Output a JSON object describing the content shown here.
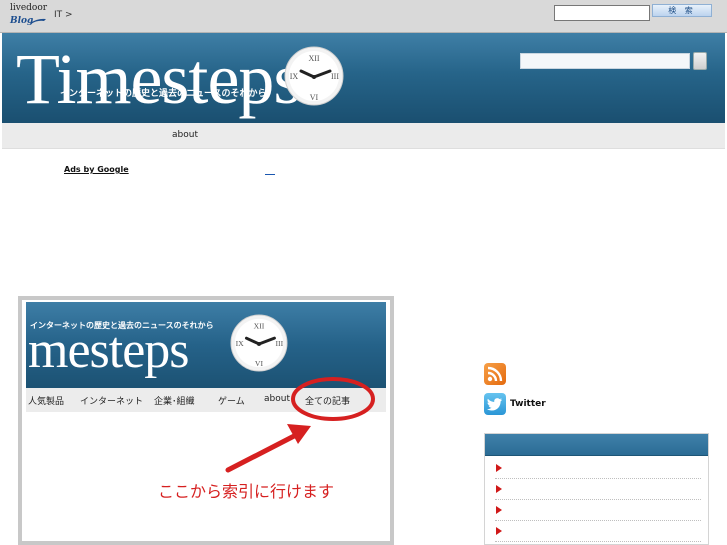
{
  "topbar": {
    "logo_text": "livedoor",
    "logo_blog": "Blog",
    "breadcrumb": "IT >",
    "search_value": "",
    "search_button": "検 索"
  },
  "header": {
    "tagline": "インターネットの歴史と過去のニュースのそれから",
    "title": "Timesteps",
    "clock_numerals": [
      "XII",
      "III",
      "VI",
      "IX"
    ],
    "search_value": ""
  },
  "nav": {
    "items": [
      "about"
    ]
  },
  "ads": {
    "label": "Ads by Google",
    "link_text": ""
  },
  "image": {
    "tagline": "インターネットの歴史と過去のニュースのそれから",
    "title": "mesteps",
    "clock_numerals": [
      "XII",
      "III",
      "VI",
      "IX"
    ],
    "nav": [
      "人気製品",
      "インターネット",
      "企業･組織",
      "ゲーム",
      "about",
      "全ての記事"
    ],
    "caption": "ここから索引に行けます"
  },
  "sidebar": {
    "rss_icon": "rss-icon",
    "twitter_icon": "twitter-bird-icon",
    "twitter_label": "Twitter",
    "box_title": "",
    "items": [
      "",
      "",
      "",
      ""
    ]
  },
  "colors": {
    "banner": "#266489",
    "accent_red": "#d62020",
    "link": "#1a57b0"
  }
}
